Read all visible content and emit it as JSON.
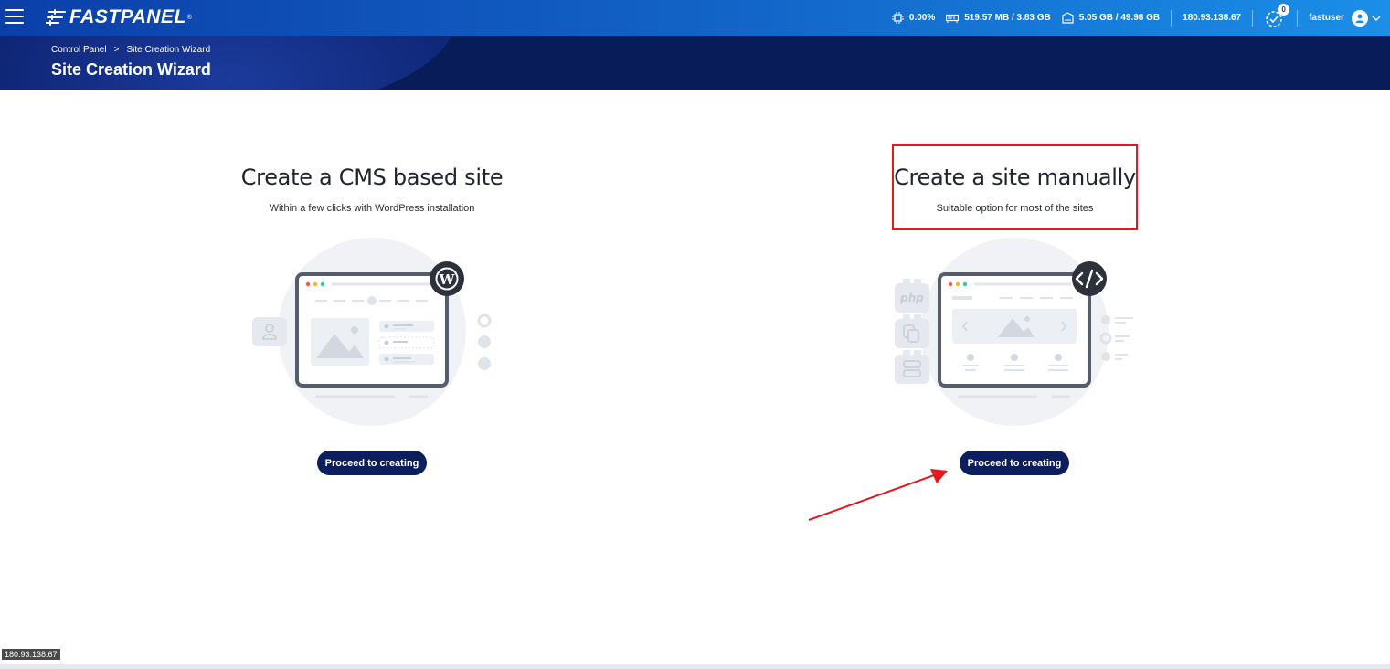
{
  "topbar": {
    "logo_text": "FASTPANEL",
    "logo_reg": "®",
    "cpu": "0.00%",
    "ram": "519.57 MB / 3.83 GB",
    "disk": "5.05 GB / 49.98 GB",
    "ip": "180.93.138.67",
    "notifications_count": "0",
    "username": "fastuser"
  },
  "breadcrumb": {
    "items": [
      "Control Panel",
      "Site Creation Wizard"
    ],
    "separator": ">"
  },
  "page": {
    "title": "Site Creation Wizard"
  },
  "options": [
    {
      "title": "Create a CMS based site",
      "subtitle": "Within a few clicks with WordPress installation",
      "button": "Proceed to creating"
    },
    {
      "title": "Create a site manually",
      "subtitle": "Suitable option for most of the sites",
      "button": "Proceed to creating"
    }
  ],
  "illustration": {
    "php_label": "php"
  },
  "status_tooltip": "180.93.138.67",
  "colors": {
    "topbar_start": "#0b3fa8",
    "topbar_end": "#1a8fe8",
    "header_bg": "#081c5a",
    "button_bg": "#0c1f5c",
    "annotation_red": "#e3181f"
  }
}
